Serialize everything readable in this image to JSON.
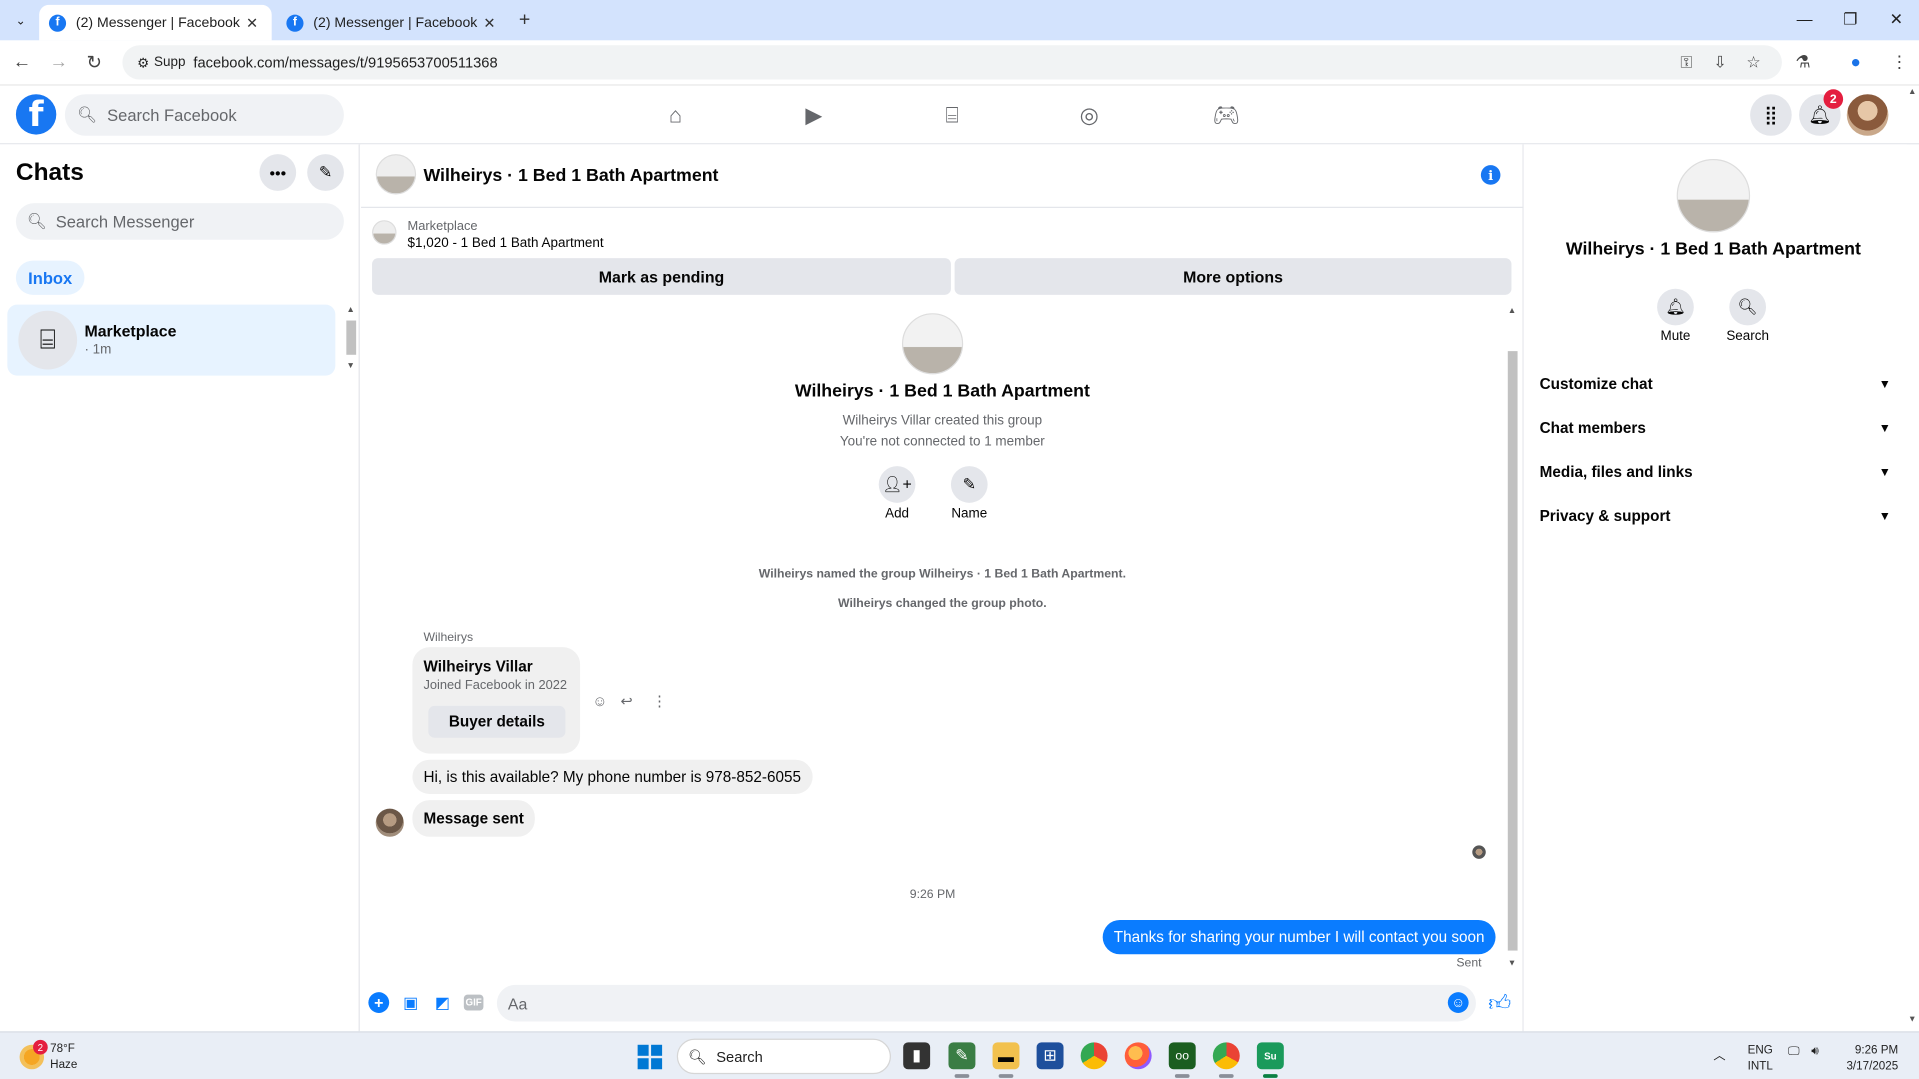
{
  "browser": {
    "tabs": [
      {
        "title": "(2) Messenger | Facebook",
        "active": true
      },
      {
        "title": "(2) Messenger | Facebook",
        "active": false
      }
    ],
    "site_chip": "Supp",
    "url": "facebook.com/messages/t/9195653700511368"
  },
  "fb_nav": {
    "search_placeholder": "Search Facebook",
    "notification_count": "2",
    "nav_icons": [
      "home-icon",
      "video-icon",
      "marketplace-icon",
      "groups-icon",
      "gaming-icon"
    ]
  },
  "chats": {
    "title": "Chats",
    "search_placeholder": "Search Messenger",
    "filter_label": "Inbox",
    "conversations": [
      {
        "name": "Marketplace",
        "meta": "· 1m"
      }
    ]
  },
  "conversation": {
    "title": "Wilheirys · 1 Bed 1 Bath Apartment",
    "marketplace_label": "Marketplace",
    "listing": "$1,020 - 1 Bed 1 Bath Apartment",
    "mark_pending_label": "Mark as pending",
    "more_options_label": "More options",
    "group_title": "Wilheirys · 1 Bed 1 Bath Apartment",
    "created_text": "Wilheirys Villar created this group",
    "connection_text": "You're not connected to 1 member",
    "add_label": "Add",
    "name_label": "Name",
    "system_messages": [
      "Wilheirys named the group Wilheirys · 1 Bed 1 Bath Apartment.",
      "Wilheirys changed the group photo."
    ],
    "sender_name": "Wilheirys",
    "buyer_card": {
      "name": "Wilheirys Villar",
      "joined": "Joined Facebook in 2022",
      "button": "Buyer details"
    },
    "incoming_messages": [
      "Hi, is this available? My phone number is 978-852-6055",
      "Message sent"
    ],
    "timestamp": "9:26 PM",
    "outgoing_message": "Thanks for sharing your number I will contact you soon",
    "sent_status": "Sent",
    "composer_placeholder": "Aa"
  },
  "info_panel": {
    "name": "Wilheirys · 1 Bed 1 Bath Apartment",
    "mute_label": "Mute",
    "search_label": "Search",
    "sections": [
      "Customize chat",
      "Chat members",
      "Media, files and links",
      "Privacy & support"
    ]
  },
  "taskbar": {
    "weather_temp": "78°F",
    "weather_desc": "Haze",
    "weather_badge": "2",
    "search_label": "Search",
    "lang_line1": "ENG",
    "lang_line2": "INTL",
    "time": "9:26 PM",
    "date": "3/17/2025"
  },
  "colors": {
    "fb_blue": "#1877f2",
    "messenger_blue": "#0a7cff",
    "badge_red": "#e41e3f"
  }
}
